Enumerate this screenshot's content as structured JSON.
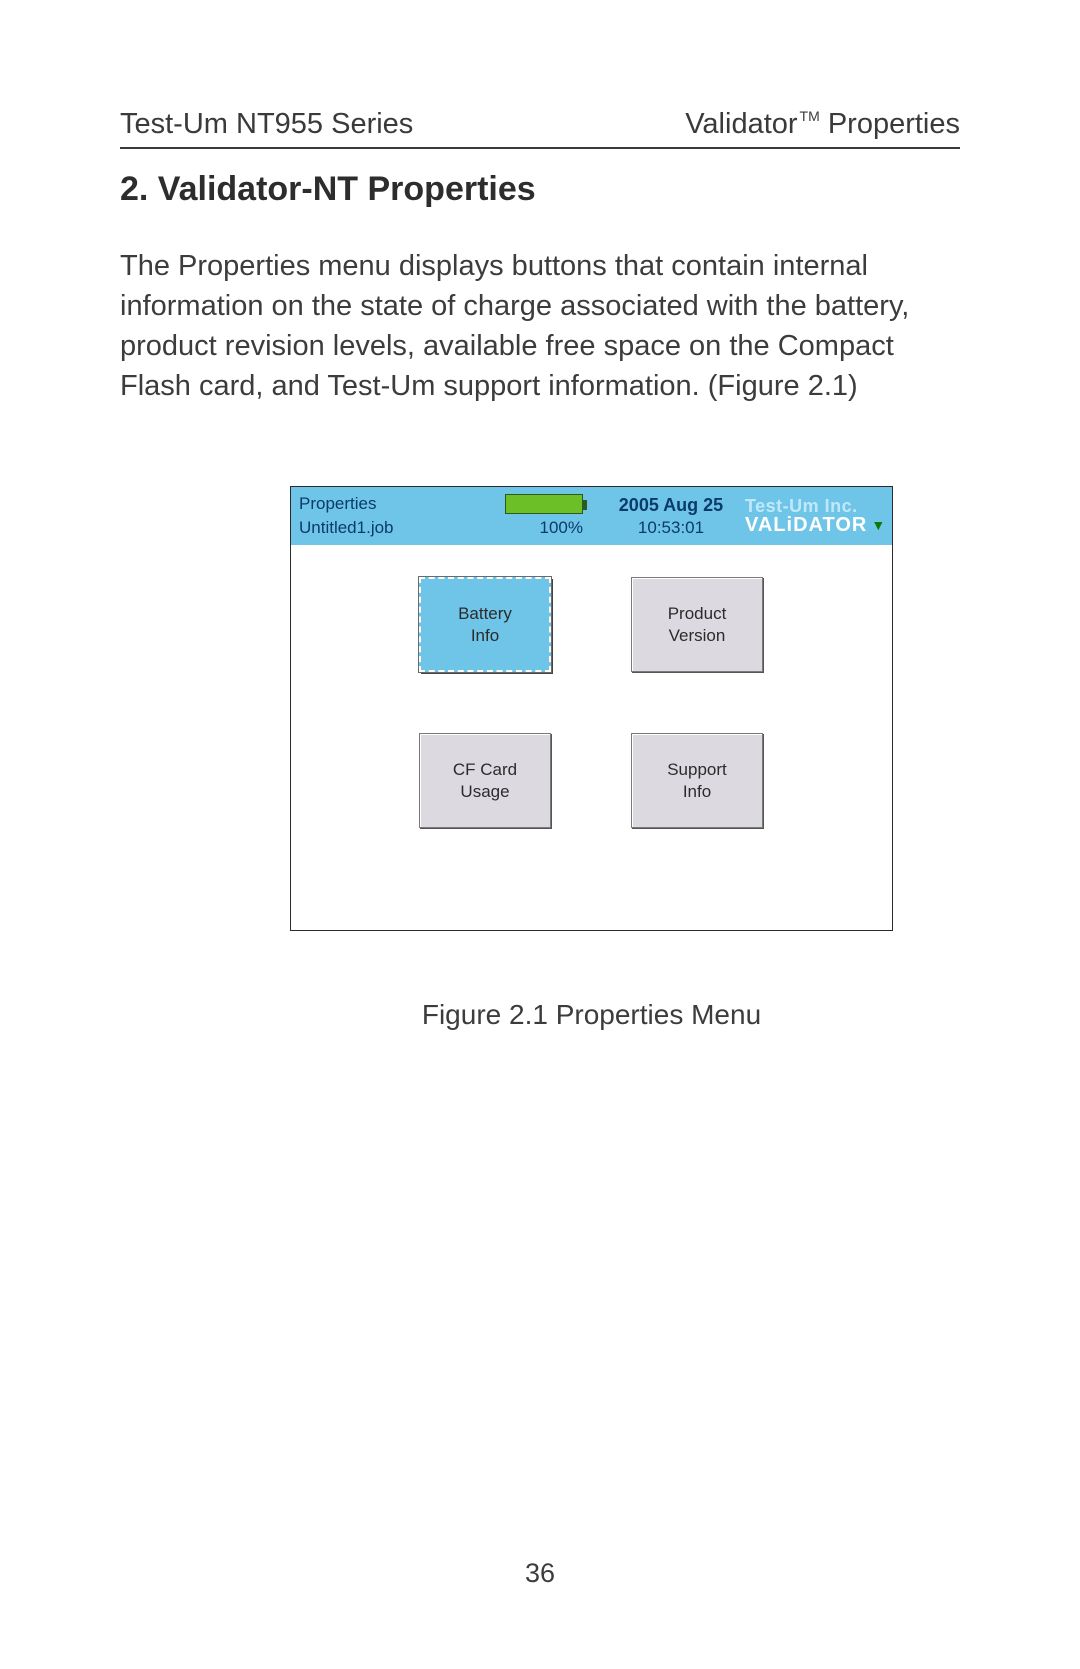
{
  "header": {
    "left": "Test-Um NT955 Series",
    "right_prefix": "Validator",
    "right_tm": "TM",
    "right_suffix": " Properties"
  },
  "section": {
    "title": "2. Validator-NT Properties",
    "paragraph": "The Properties menu displays buttons that contain internal information on the state of charge associated with the battery, product revision levels, available free space on the Compact Flash card, and Test-Um support information. (Figure 2.1)"
  },
  "device": {
    "screen_title": "Properties",
    "job_file": "Untitled1.job",
    "battery_percent": "100%",
    "date": "2005 Aug 25",
    "time": "10:53:01",
    "brand_line1": "Test-Um Inc.",
    "brand_line2": "VALiDATOR",
    "buttons": {
      "battery": "Battery\nInfo",
      "product": "Product\nVersion",
      "cf": "CF Card\nUsage",
      "support": "Support\nInfo"
    }
  },
  "figure_caption": "Figure 2.1 Properties Menu",
  "page_number": "36"
}
